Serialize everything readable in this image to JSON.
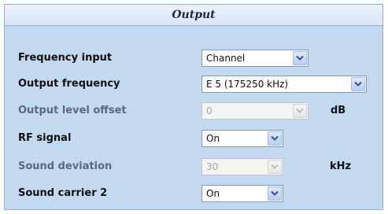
{
  "panel": {
    "title": "Output"
  },
  "fields": {
    "frequency_input": {
      "label": "Frequency input",
      "value": "Channel"
    },
    "output_frequency": {
      "label": "Output frequency",
      "value": "E 5 (175250 kHz)"
    },
    "output_level_offset": {
      "label": "Output level offset",
      "value": "0",
      "unit": "dB"
    },
    "rf_signal": {
      "label": "RF signal",
      "value": "On"
    },
    "sound_deviation": {
      "label": "Sound deviation",
      "value": "30",
      "unit": "kHz"
    },
    "sound_carrier_2": {
      "label": "Sound carrier 2",
      "value": "On"
    }
  },
  "icons": {
    "dropdown": "chevron-down-icon"
  },
  "colors": {
    "panel_bg": "#c3d9f0",
    "disabled_text": "#a8a8a8"
  }
}
